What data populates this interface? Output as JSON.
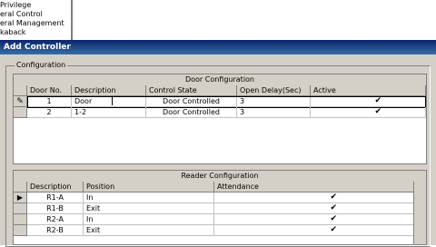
{
  "tree": {
    "items": [
      "Privilege",
      "eral Control",
      "eral Management",
      "kaback"
    ]
  },
  "dialog": {
    "title": "Add Controller",
    "group_label": "Configuration"
  },
  "door_config": {
    "caption": "Door Configuration",
    "columns": [
      "Door No.",
      "Description",
      "Control State",
      "Open Delay(Sec)",
      "Active"
    ],
    "rows": [
      {
        "door_no": "1",
        "description": "Door",
        "control_state": "Door Controlled",
        "open_delay": "3",
        "active": "✔"
      },
      {
        "door_no": "2",
        "description": "1-2",
        "control_state": "Door Controlled",
        "open_delay": "3",
        "active": "✔"
      }
    ],
    "edit_indicator": "✎"
  },
  "reader_config": {
    "caption": "Reader Configuration",
    "columns": [
      "Description",
      "Position",
      "Attendance"
    ],
    "rows": [
      {
        "description": "R1-A",
        "position": "In",
        "attendance": "✔"
      },
      {
        "description": "R1-B",
        "position": "Exit",
        "attendance": "✔"
      },
      {
        "description": "R2-A",
        "position": "In",
        "attendance": "✔"
      },
      {
        "description": "R2-B",
        "position": "Exit",
        "attendance": "✔"
      }
    ],
    "current_indicator": "▶"
  }
}
